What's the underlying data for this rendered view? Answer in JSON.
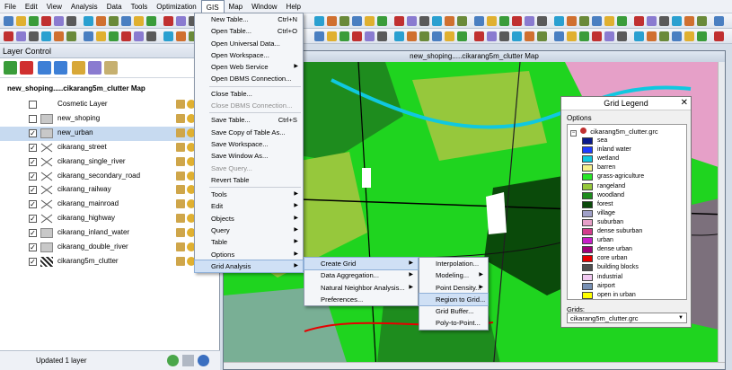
{
  "menubar": [
    "File",
    "Edit",
    "View",
    "Analysis",
    "Data",
    "Tools",
    "Optimization",
    "GIS",
    "Map",
    "Window",
    "Help"
  ],
  "layer_control": {
    "title": "Layer Control",
    "map_name": "new_shoping.....cikarang5m_clutter Map",
    "layers": [
      {
        "name": "Cosmetic Layer",
        "checked": false,
        "sym": "none"
      },
      {
        "name": "new_shoping",
        "checked": false,
        "sym": "region"
      },
      {
        "name": "new_urban",
        "checked": true,
        "sym": "region",
        "selected": true
      },
      {
        "name": "cikarang_street",
        "checked": true,
        "sym": "line"
      },
      {
        "name": "cikarang_single_river",
        "checked": true,
        "sym": "line"
      },
      {
        "name": "cikarang_secondary_road",
        "checked": true,
        "sym": "line"
      },
      {
        "name": "cikarang_railway",
        "checked": true,
        "sym": "line"
      },
      {
        "name": "cikarang_mainroad",
        "checked": true,
        "sym": "line"
      },
      {
        "name": "cikarang_highway",
        "checked": true,
        "sym": "line"
      },
      {
        "name": "cikarang_inland_water",
        "checked": true,
        "sym": "region"
      },
      {
        "name": "cikarang_double_river",
        "checked": true,
        "sym": "region"
      },
      {
        "name": "cikarang5m_clutter",
        "checked": true,
        "sym": "grid"
      }
    ],
    "status": "Updated 1 layer"
  },
  "map_window": {
    "title": "new_shoping.....cikarang5m_clutter Map"
  },
  "gis_menu": [
    {
      "label": "New Table...",
      "shortcut": "Ctrl+N"
    },
    {
      "label": "Open Table...",
      "shortcut": "Ctrl+O"
    },
    {
      "label": "Open Universal Data..."
    },
    {
      "label": "Open Workspace..."
    },
    {
      "label": "Open Web Service",
      "arrow": true
    },
    {
      "label": "Open DBMS Connection..."
    },
    {
      "sep": true
    },
    {
      "label": "Close Table..."
    },
    {
      "label": "Close DBMS Connection...",
      "disabled": true
    },
    {
      "sep": true
    },
    {
      "label": "Save Table...",
      "shortcut": "Ctrl+S"
    },
    {
      "label": "Save Copy of Table As..."
    },
    {
      "label": "Save Workspace..."
    },
    {
      "label": "Save Window As..."
    },
    {
      "label": "Save Query...",
      "disabled": true
    },
    {
      "label": "Revert Table"
    },
    {
      "sep": true
    },
    {
      "label": "Tools",
      "arrow": true
    },
    {
      "label": "Edit",
      "arrow": true
    },
    {
      "label": "Objects",
      "arrow": true
    },
    {
      "label": "Query",
      "arrow": true
    },
    {
      "label": "Table",
      "arrow": true
    },
    {
      "label": "Options",
      "arrow": true
    },
    {
      "label": "Grid Analysis",
      "arrow": true,
      "highlight": true
    }
  ],
  "grid_analysis_menu": [
    {
      "label": "Create Grid",
      "arrow": true,
      "highlight": true
    },
    {
      "label": "Data Aggregation...",
      "arrow": true
    },
    {
      "label": "Natural Neighbor Analysis...",
      "arrow": true
    },
    {
      "label": "Preferences..."
    }
  ],
  "create_grid_menu": [
    {
      "label": "Interpolation..."
    },
    {
      "label": "Modeling...",
      "arrow": true
    },
    {
      "label": "Point Density...",
      "arrow": true
    },
    {
      "label": "Region to Grid...",
      "highlight": true
    },
    {
      "label": "Grid Buffer..."
    },
    {
      "label": "Poly-to-Point..."
    }
  ],
  "grid_legend": {
    "title": "Grid Legend",
    "options_label": "Options",
    "root": "cikarang5m_clutter.grc",
    "entries": [
      {
        "label": "sea",
        "color": "#0a1a8c"
      },
      {
        "label": "inland water",
        "color": "#1e3cff"
      },
      {
        "label": "wetland",
        "color": "#10c8e0"
      },
      {
        "label": "barren",
        "color": "#f5f08c"
      },
      {
        "label": "grass-agriculture",
        "color": "#28e628"
      },
      {
        "label": "rangeland",
        "color": "#96c83c"
      },
      {
        "label": "woodland",
        "color": "#1e8c1e"
      },
      {
        "label": "forest",
        "color": "#0a4a0a"
      },
      {
        "label": "village",
        "color": "#a0a0c8"
      },
      {
        "label": "suburban",
        "color": "#e6a0c8"
      },
      {
        "label": "dense suburban",
        "color": "#d23c8c"
      },
      {
        "label": "urban",
        "color": "#c81ec8"
      },
      {
        "label": "dense urban",
        "color": "#a00078"
      },
      {
        "label": "core urban",
        "color": "#e60000"
      },
      {
        "label": "building blocks",
        "color": "#505050"
      },
      {
        "label": "industrial",
        "color": "#f0c8f0"
      },
      {
        "label": "airport",
        "color": "#7890b4"
      },
      {
        "label": "open in urban",
        "color": "#ffff00"
      }
    ],
    "grids_label": "Grids:",
    "grids_value": "cikarang5m_clutter.grc"
  }
}
